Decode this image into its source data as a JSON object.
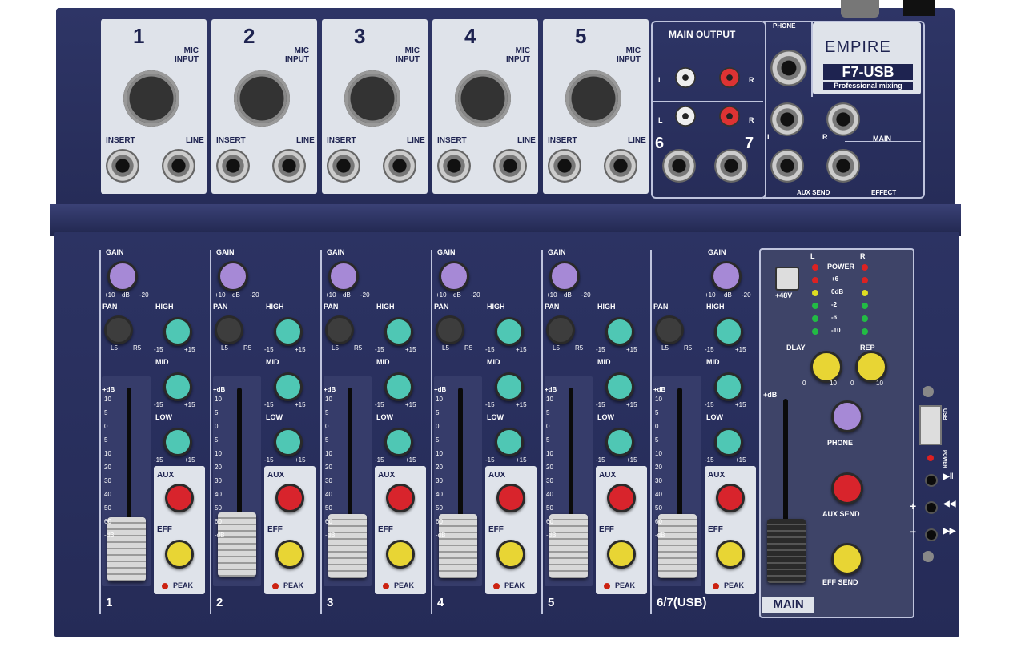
{
  "brand": {
    "name": "EMPIRE",
    "model": "F7-USB",
    "tagline": "Professional mixing"
  },
  "channels": [
    {
      "number": "1",
      "mic_label": "MIC\nINPUT",
      "insert": "INSERT",
      "line": "LINE",
      "strip_label": "1"
    },
    {
      "number": "2",
      "mic_label": "MIC\nINPUT",
      "insert": "INSERT",
      "line": "LINE",
      "strip_label": "2"
    },
    {
      "number": "3",
      "mic_label": "MIC\nINPUT",
      "insert": "INSERT",
      "line": "LINE",
      "strip_label": "3"
    },
    {
      "number": "4",
      "mic_label": "MIC\nINPUT",
      "insert": "INSERT",
      "line": "LINE",
      "strip_label": "4"
    },
    {
      "number": "5",
      "mic_label": "MIC\nINPUT",
      "insert": "INSERT",
      "line": "LINE",
      "strip_label": "5"
    }
  ],
  "stereo_strip_label": "6/7(USB)",
  "main_output": {
    "title": "MAIN OUTPUT",
    "l": "L",
    "r": "R",
    "ch6": "6",
    "ch7": "7"
  },
  "outputs": {
    "phone": "PHONE",
    "main": "MAIN",
    "aux_send": "AUX SEND",
    "effect": "EFFECT",
    "l": "L",
    "r": "R"
  },
  "strip_labels": {
    "gain": "GAIN",
    "gain_scale_left": "+10",
    "gain_scale_mid": "dB",
    "gain_scale_right": "-20",
    "pan": "PAN",
    "pan_l": "L5",
    "pan_r": "R5",
    "high": "HIGH",
    "mid": "MID",
    "low": "LOW",
    "eq_min": "-15",
    "eq_max": "+15",
    "aux": "AUX",
    "eff": "EFF",
    "peak": "PEAK",
    "db": "+dB"
  },
  "fader_scale": [
    "10",
    "5",
    "0",
    "5",
    "10",
    "20",
    "30",
    "40",
    "50",
    "60",
    "-dB"
  ],
  "master": {
    "phantom": "+48V",
    "power": "POWER",
    "meter_l": "L",
    "meter_r": "R",
    "meter_marks": [
      "+6",
      "0dB",
      "-2",
      "-6",
      "-10"
    ],
    "delay": "DLAY",
    "rep": "REP",
    "phone": "PHONE",
    "aux_send": "AUX SEND",
    "eff_send": "EFF SEND",
    "main": "MAIN",
    "k0": "0",
    "k10": "10"
  },
  "usb_panel": {
    "usb": "USB",
    "power": "POWER",
    "plus": "+",
    "minus": "−"
  },
  "colors": {
    "panel": "#272d5a",
    "card": "#dfe3ea",
    "gain_knob": "#a689d6",
    "eq_knob": "#4fc7b4",
    "aux_knob": "#d8242c",
    "eff_knob": "#e8d534",
    "main_label_bg": "#dfe3ea"
  }
}
